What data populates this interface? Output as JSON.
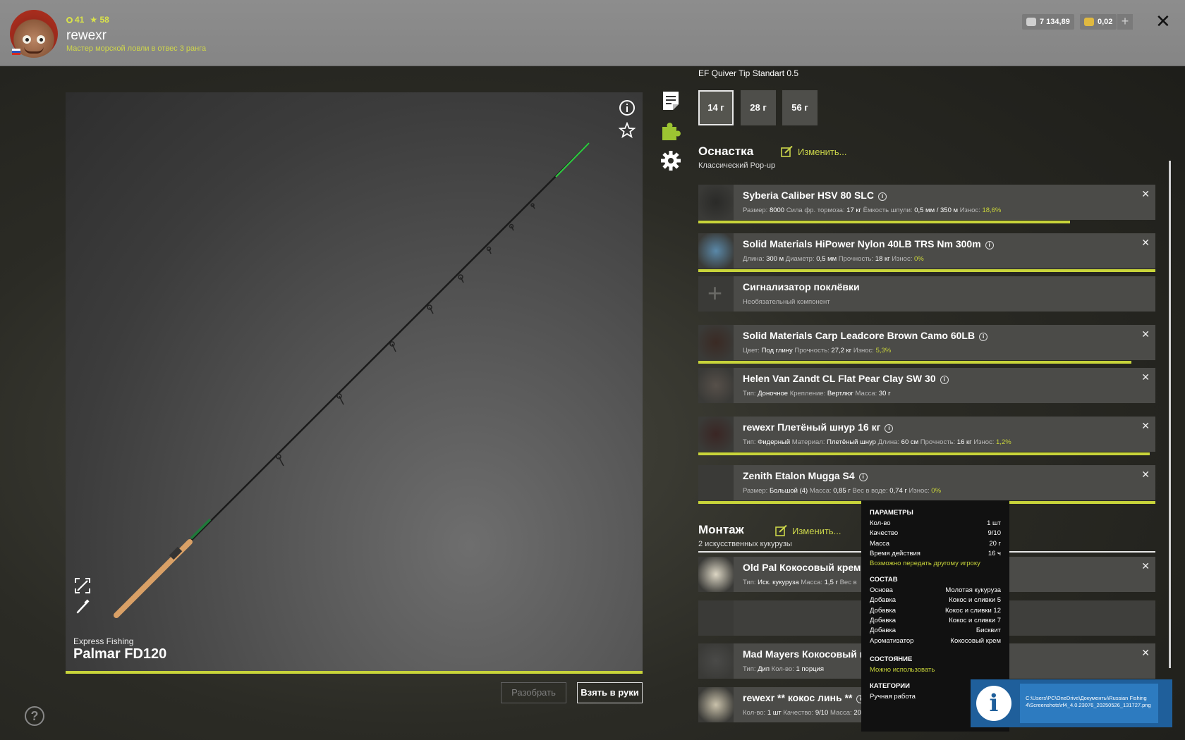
{
  "player": {
    "level": "41",
    "stars": "58",
    "name": "rewexr",
    "rank": "Мастер морской ловли в отвес 3 ранга"
  },
  "wallet": {
    "silver": "7 134,89",
    "gold": "0,02"
  },
  "rod": {
    "brand": "Express Fishing",
    "name": "Palmar FD120",
    "disassemble_label": "Разобрать",
    "take_label": "Взять в руки",
    "colors": {
      "rod_tip": "#2ecc40",
      "handle": "#d9a066",
      "wear_bar": "#c8d43a"
    }
  },
  "tip": {
    "name": "EF Quiver Tip Standart 0.5",
    "weights": [
      "14 г",
      "28 г",
      "56 г"
    ],
    "active_index": 0
  },
  "rigging": {
    "title": "Оснастка",
    "subtitle": "Классический Pop-up",
    "edit_label": "Изменить..."
  },
  "components": [
    {
      "name": "Syberia Caliber HSV 80 SLC",
      "stats": [
        {
          "label": "Размер:",
          "value": "8000"
        },
        {
          "label": "Сила фр. тормоза:",
          "value": "17 кг"
        },
        {
          "label": "Ёмкость шпули:",
          "value": "0,5 мм / 350 м"
        },
        {
          "label": "Износ:",
          "value": "18,6%",
          "accent": true
        }
      ],
      "wear_pct": 81.4,
      "removable": true
    },
    {
      "name": "Solid Materials HiPower Nylon 40LB TRS Nm 300m",
      "stats": [
        {
          "label": "Длина:",
          "value": "300 м"
        },
        {
          "label": "Диаметр:",
          "value": "0,5 мм"
        },
        {
          "label": "Прочность:",
          "value": "18 кг"
        },
        {
          "label": "Износ:",
          "value": "0%",
          "accent": true
        }
      ],
      "wear_pct": 100,
      "removable": true
    },
    {
      "name": "Сигнализатор поклёвки",
      "stats": [
        {
          "label": "Необязательный компонент",
          "value": ""
        }
      ],
      "wear_pct": 0,
      "removable": false,
      "empty": true
    },
    {
      "name": "Solid Materials Carp Leadcore Brown Camo 60LB",
      "stats": [
        {
          "label": "Цвет:",
          "value": "Под глину"
        },
        {
          "label": "Прочность:",
          "value": "27,2 кг"
        },
        {
          "label": "Износ:",
          "value": "5,3%",
          "accent": true
        }
      ],
      "wear_pct": 94.7,
      "removable": true
    },
    {
      "name": "Helen Van Zandt CL Flat Pear Clay SW 30",
      "stats": [
        {
          "label": "Тип:",
          "value": "Доночное"
        },
        {
          "label": "Крепление:",
          "value": "Вертлюг"
        },
        {
          "label": "Масса:",
          "value": "30 г"
        }
      ],
      "wear_pct": 0,
      "removable": true
    },
    {
      "name": "rewexr Плетёный шнур 16 кг",
      "stats": [
        {
          "label": "Тип:",
          "value": "Фидерный"
        },
        {
          "label": "Материал:",
          "value": "Плетёный шнур"
        },
        {
          "label": "Длина:",
          "value": "60 см"
        },
        {
          "label": "Прочность:",
          "value": "16 кг"
        },
        {
          "label": "Износ:",
          "value": "1,2%",
          "accent": true
        }
      ],
      "wear_pct": 98.8,
      "removable": true
    },
    {
      "name": "Zenith Etalon Mugga S4",
      "stats": [
        {
          "label": "Размер:",
          "value": "Большой (4)"
        },
        {
          "label": "Масса:",
          "value": "0,85 г"
        },
        {
          "label": "Вес в воде:",
          "value": "0,74 г"
        },
        {
          "label": "Износ:",
          "value": "0%",
          "accent": true
        }
      ],
      "wear_pct": 100,
      "removable": true
    }
  ],
  "mounting": {
    "title": "Монтаж",
    "subtitle": "2 искусственных кукурузы",
    "edit_label": "Изменить..."
  },
  "baits": [
    {
      "name": "Old Pal Кокосовый крем",
      "stats": [
        {
          "label": "Тип:",
          "value": "Иск. кукуруза"
        },
        {
          "label": "Масса:",
          "value": "1,5 г"
        },
        {
          "label": "Вес в",
          "value": ""
        }
      ],
      "removable": true
    },
    {
      "name": "",
      "stats": [],
      "removable": false,
      "empty": true
    },
    {
      "name": "Mad Mayers Кокосовый н",
      "stats": [
        {
          "label": "Тип:",
          "value": "Дип"
        },
        {
          "label": "Кол-во:",
          "value": "1 порция"
        }
      ],
      "removable": true
    },
    {
      "name": "rewexr ** кокос линь **",
      "stats": [
        {
          "label": "Кол-во:",
          "value": "1 шт"
        },
        {
          "label": "Качество:",
          "value": "9/10"
        },
        {
          "label": "Масса:",
          "value": "20 г"
        }
      ],
      "removable": true
    }
  ],
  "tooltip": {
    "params_title": "ПАРАМЕТРЫ",
    "params": [
      {
        "k": "Кол-во",
        "v": "1 шт"
      },
      {
        "k": "Качество",
        "v": "9/10"
      },
      {
        "k": "Масса",
        "v": "20 г"
      },
      {
        "k": "Время действия",
        "v": "16 ч"
      }
    ],
    "transfer_note": "Возможно передать другому игроку",
    "composition_title": "СОСТАВ",
    "composition": [
      {
        "k": "Основа",
        "v": "Молотая кукуруза"
      },
      {
        "k": "Добавка",
        "v": "Кокос и сливки 5"
      },
      {
        "k": "Добавка",
        "v": "Кокос и сливки 12"
      },
      {
        "k": "Добавка",
        "v": "Кокос и сливки 7"
      },
      {
        "k": "Добавка",
        "v": "Бисквит"
      },
      {
        "k": "Ароматизатор",
        "v": "Кокосовый крем"
      }
    ],
    "state_title": "СОСТОЯНИЕ",
    "state_value": "Можно использовать",
    "categories_title": "КАТЕГОРИИ",
    "categories_value": "Ручная работа"
  },
  "notification": {
    "text": "C:\\Users\\PC\\OneDrive\\Документы\\Russian Fishing 4\\Screenshots\\rf4_4.0.23076_20250526_131727.png"
  },
  "icons": [
    "info-icon",
    "star-icon",
    "expand-icon",
    "brush-icon",
    "notes-icon",
    "puzzle-icon",
    "gear-icon",
    "help-icon",
    "close-icon",
    "plus-icon"
  ]
}
